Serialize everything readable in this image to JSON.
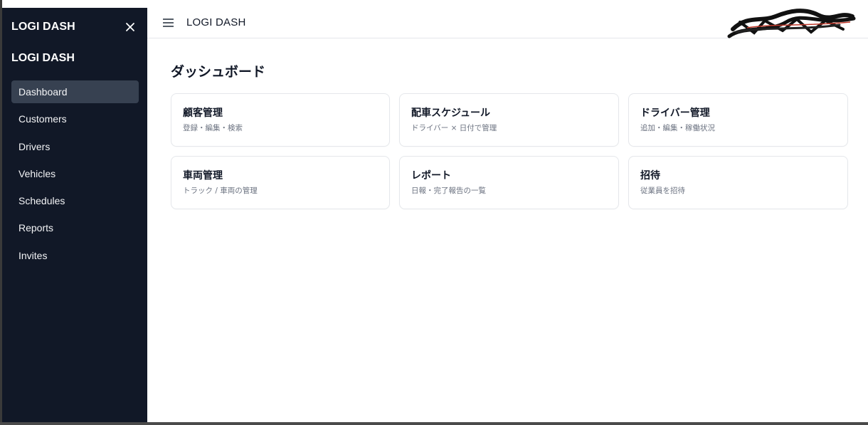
{
  "app": {
    "brand": "LOGI DASH"
  },
  "sidebar": {
    "brand": "LOGI DASH",
    "brand_secondary": "LOGI DASH",
    "items": [
      {
        "label": "Dashboard",
        "active": true
      },
      {
        "label": "Customers"
      },
      {
        "label": "Drivers"
      },
      {
        "label": "Vehicles"
      },
      {
        "label": "Schedules"
      },
      {
        "label": "Reports"
      },
      {
        "label": "Invites"
      }
    ],
    "close_icon": "close-icon"
  },
  "topbar": {
    "title": "LOGI DASH",
    "menu_icon": "hamburger-menu-icon"
  },
  "main": {
    "title": "ダッシュボード",
    "cards": [
      {
        "title": "顧客管理",
        "subtitle": "登録・編集・検索"
      },
      {
        "title": "配車スケジュール",
        "subtitle": "ドライバー × 日付で管理"
      },
      {
        "title": "ドライバー管理",
        "subtitle": "追加・編集・稼働状況"
      },
      {
        "title": "車両管理",
        "subtitle": "トラック / 車両の管理"
      },
      {
        "title": "レポート",
        "subtitle": "日報・完了報告の一覧"
      },
      {
        "title": "招待",
        "subtitle": "従業員を招待"
      }
    ]
  },
  "colors": {
    "sidebar_bg": "#111827",
    "active_item_bg": "#374151",
    "text_primary": "#111827",
    "text_muted": "#6b7280",
    "border": "#e5e7eb"
  }
}
